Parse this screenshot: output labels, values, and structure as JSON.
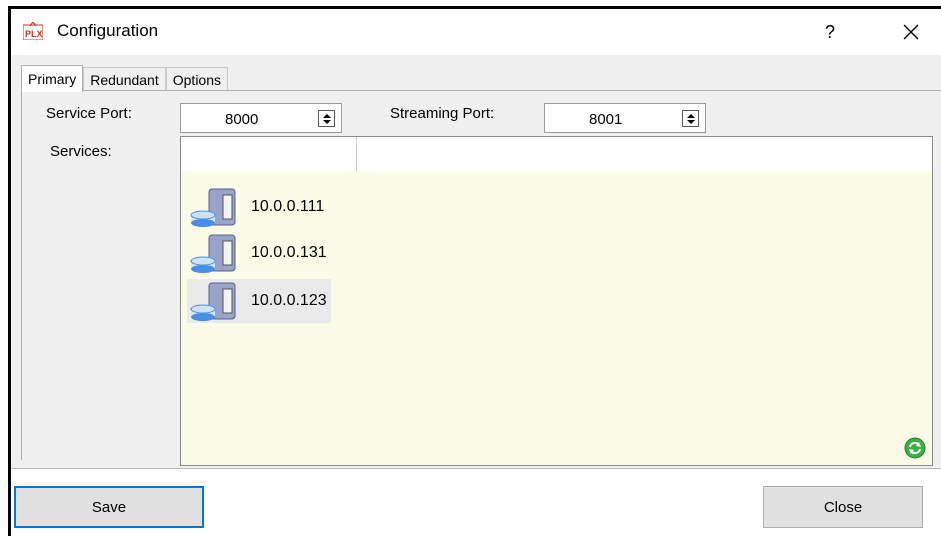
{
  "window": {
    "title": "Configuration",
    "help_label": "?",
    "close_label": "✕"
  },
  "tabs": [
    {
      "label": "Primary",
      "active": true
    },
    {
      "label": "Redundant",
      "active": false
    },
    {
      "label": "Options",
      "active": false
    }
  ],
  "ports": {
    "service_label": "Service Port:",
    "service_value": "8000",
    "streaming_label": "Streaming Port:",
    "streaming_value": "8001"
  },
  "services": {
    "label": "Services:",
    "items": [
      {
        "label": "10.0.0.111",
        "selected": false
      },
      {
        "label": "10.0.0.131",
        "selected": false
      },
      {
        "label": "10.0.0.123",
        "selected": true
      }
    ]
  },
  "footer": {
    "save_label": "Save",
    "close_label": "Close"
  },
  "colors": {
    "accent": "#0078d7",
    "list_bg": "#fbfce7",
    "panel_bg": "#f0f0f0",
    "refresh": "#3cb043"
  },
  "icons": {
    "app": "plx-app-icon",
    "server": "server-database-icon",
    "refresh": "refresh-icon"
  }
}
